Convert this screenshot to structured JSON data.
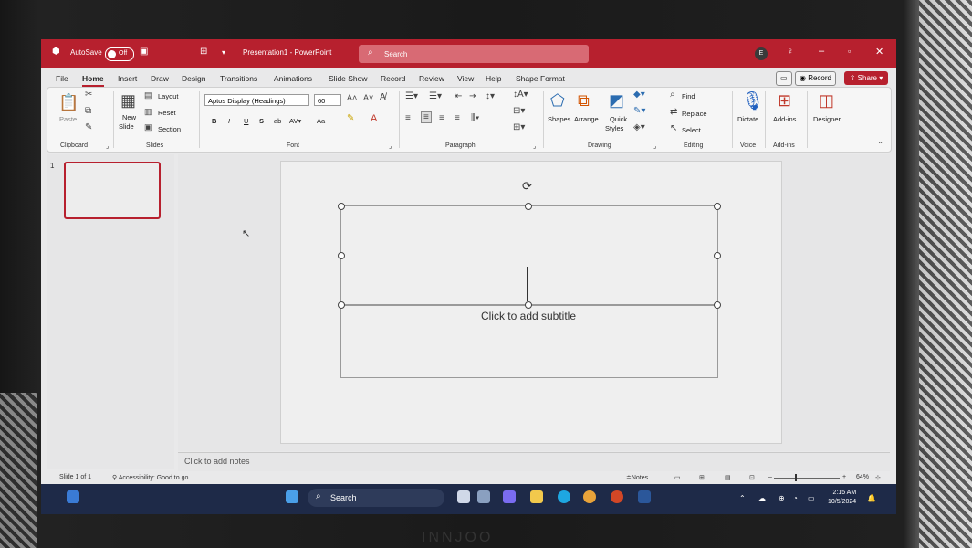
{
  "titlebar": {
    "autosave": "AutoSave",
    "autosave_state": "Off",
    "document_title": "Presentation1  -  PowerPoint",
    "search_placeholder": "Search",
    "avatar": "E"
  },
  "tabs": [
    "File",
    "Home",
    "Insert",
    "Draw",
    "Design",
    "Transitions",
    "Animations",
    "Slide Show",
    "Record",
    "Review",
    "View",
    "Help",
    "Shape Format"
  ],
  "tab_actions": {
    "record": "Record",
    "share": "Share"
  },
  "ribbon": {
    "clipboard": {
      "paste": "Paste",
      "group": "Clipboard"
    },
    "slides": {
      "new_slide": "New",
      "new_slide2": "Slide",
      "layout": "Layout",
      "reset": "Reset",
      "section": "Section",
      "group": "Slides"
    },
    "font": {
      "font_name": "Aptos Display (Headings)",
      "font_size": "60",
      "bold": "B",
      "italic": "I",
      "underline": "U",
      "strike": "S",
      "case": "Aa",
      "group": "Font"
    },
    "paragraph": {
      "group": "Paragraph"
    },
    "drawing": {
      "shapes": "Shapes",
      "arrange": "Arrange",
      "quick": "Quick",
      "styles": "Styles",
      "group": "Drawing"
    },
    "editing": {
      "find": "Find",
      "replace": "Replace",
      "select": "Select",
      "group": "Editing"
    },
    "voice": {
      "dictate": "Dictate",
      "group": "Voice"
    },
    "addins": {
      "addins": "Add-ins",
      "group": "Add-ins"
    },
    "designer": {
      "designer": "Designer"
    }
  },
  "slides_pane": {
    "slide_number": "1"
  },
  "slide": {
    "subtitle_placeholder": "Click to add subtitle"
  },
  "notes": {
    "placeholder": "Click to add notes"
  },
  "statusbar": {
    "slide_of": "Slide 1 of 1",
    "accessibility": "Accessibility: Good to go",
    "notes": "Notes",
    "zoom": "64%"
  },
  "taskbar": {
    "search": "Search",
    "time": "2:15 AM",
    "date": "10/5/2024"
  },
  "colors": {
    "accent": "#b7202e",
    "taskbar": "#1e2a48"
  }
}
